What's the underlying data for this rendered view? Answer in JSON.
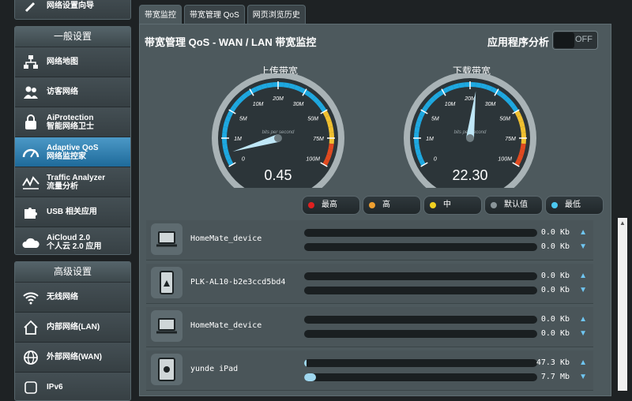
{
  "sidebar": {
    "top_item": "网络设置向导",
    "general": {
      "header": "一般设置",
      "items": [
        {
          "label": "网络地图",
          "sub": "",
          "icon": "network-map-icon"
        },
        {
          "label": "访客网络",
          "sub": "",
          "icon": "guest-network-icon"
        },
        {
          "label": "AiProtection",
          "sub": "智能网络卫士",
          "icon": "lock-icon"
        },
        {
          "label": "Adaptive QoS",
          "sub": "网络监控家",
          "icon": "speedometer-icon"
        },
        {
          "label": "Traffic Analyzer",
          "sub": "流量分析",
          "icon": "traffic-chart-icon"
        },
        {
          "label": "USB 相关应用",
          "sub": "",
          "icon": "puzzle-icon"
        },
        {
          "label": "AiCloud 2.0",
          "sub": "个人云 2.0 应用",
          "icon": "cloud-home-icon"
        }
      ]
    },
    "advanced": {
      "header": "高级设置",
      "items": [
        {
          "label": "无线网络",
          "icon": "wifi-icon"
        },
        {
          "label": "内部网络(LAN)",
          "icon": "home-icon"
        },
        {
          "label": "外部网络(WAN)",
          "icon": "globe-icon"
        },
        {
          "label": "IPv6",
          "icon": "ipv6-icon"
        }
      ]
    }
  },
  "tabs": [
    "带宽监控",
    "带宽管理 QoS",
    "网页浏览历史"
  ],
  "panel": {
    "title": "带宽管理 QoS - WAN / LAN 带宽监控",
    "app_analysis": "应用程序分析",
    "toggle_state": "OFF"
  },
  "gauges": {
    "ticks": [
      "0",
      "1M",
      "5M",
      "10M",
      "20M",
      "30M",
      "50M",
      "75M",
      "100M"
    ],
    "subtitle": "bits per second",
    "upload": {
      "label": "上传带宽",
      "value": "0.45"
    },
    "download": {
      "label": "下载带宽",
      "value": "22.30"
    }
  },
  "legend": [
    {
      "label": "最高",
      "color": "#e02020"
    },
    {
      "label": "高",
      "color": "#f0a030"
    },
    {
      "label": "中",
      "color": "#f0d020"
    },
    {
      "label": "默认值",
      "color": "#8a9599"
    },
    {
      "label": "最低",
      "color": "#4cc8f0"
    }
  ],
  "devices": [
    {
      "name": "HomeMate_device",
      "icon": "laptop-icon",
      "up": "0.0 Kb",
      "down": "0.0 Kb",
      "up_fill": 0,
      "down_fill": 0
    },
    {
      "name": "PLK-AL10-b2e3ccd5bd4",
      "icon": "phone-icon",
      "up": "0.0 Kb",
      "down": "0.0 Kb",
      "up_fill": 0,
      "down_fill": 0
    },
    {
      "name": "HomeMate_device",
      "icon": "laptop-icon",
      "up": "0.0 Kb",
      "down": "0.0 Kb",
      "up_fill": 0,
      "down_fill": 0
    },
    {
      "name": "yunde iPad",
      "icon": "tablet-icon",
      "up": "47.3 Kb",
      "down": "7.7 Mb",
      "up_fill": 0.01,
      "down_fill": 0.05
    }
  ]
}
